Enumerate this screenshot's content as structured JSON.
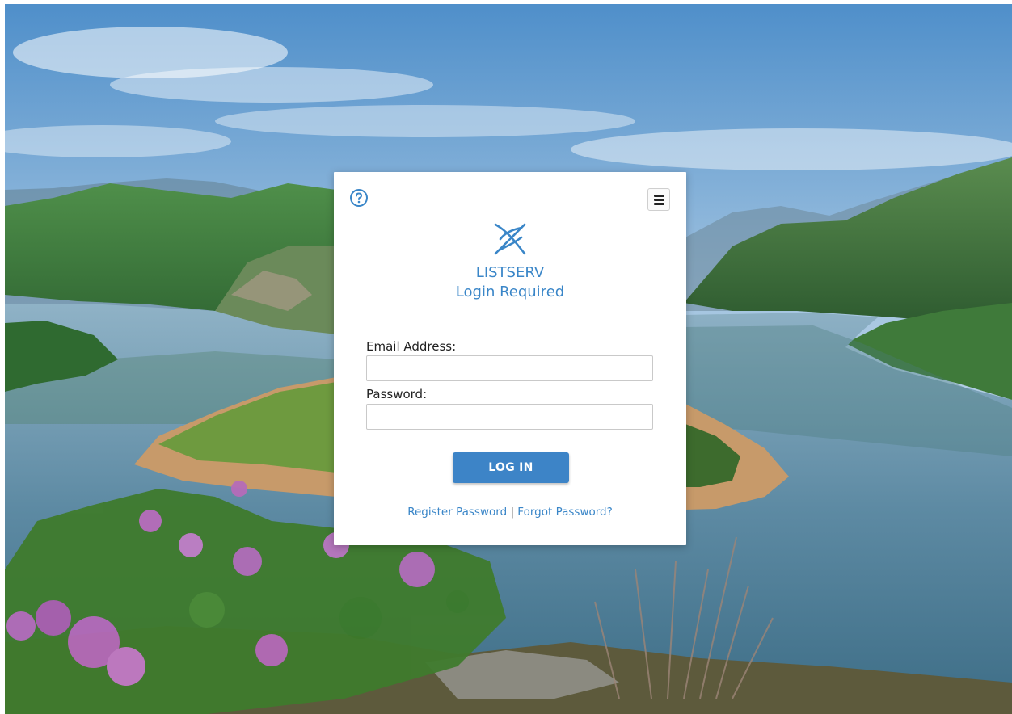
{
  "brand": {
    "name": "LISTSERV",
    "subtitle": "Login Required"
  },
  "form": {
    "email_label": "Email Address:",
    "email_value": "",
    "password_label": "Password:",
    "password_value": "",
    "login_label": "LOG IN"
  },
  "links": {
    "register": "Register Password",
    "separator": "|",
    "forgot": "Forgot Password?"
  },
  "icons": {
    "help": "help-circle-icon",
    "menu": "hamburger-menu-icon",
    "logo": "listserv-logo-icon"
  },
  "colors": {
    "accent": "#3a86c8",
    "button": "#3d84c7"
  }
}
